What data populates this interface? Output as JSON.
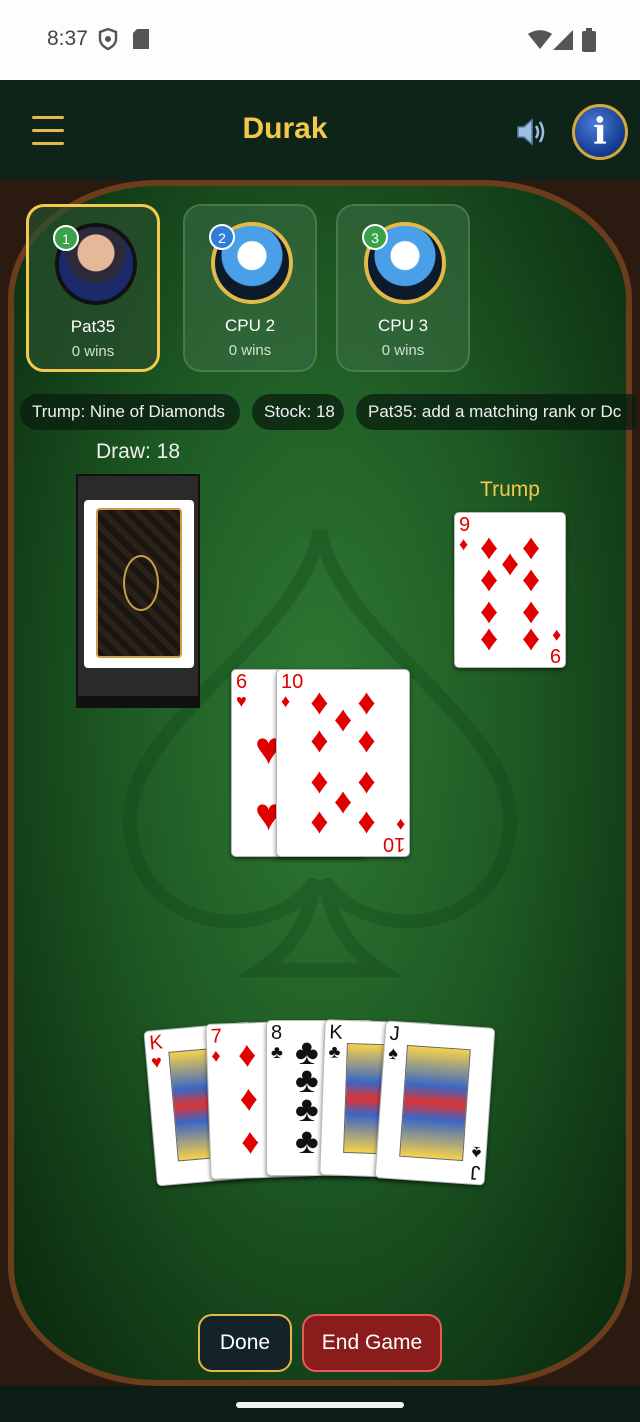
{
  "status_bar": {
    "time": "8:37",
    "icons": [
      "shield-icon",
      "sim-card-icon",
      "wifi-icon",
      "signal-icon",
      "battery-icon"
    ]
  },
  "app_bar": {
    "title": "Durak",
    "menu_icon": "hamburger-icon",
    "sound_icon": "speaker-icon",
    "info_icon": "info-icon",
    "info_glyph": "i"
  },
  "players": [
    {
      "badge": "1",
      "name": "Pat35",
      "wins": "0 wins",
      "active": true,
      "badge_color": "#3aa34a"
    },
    {
      "badge": "2",
      "name": "CPU 2",
      "wins": "0 wins",
      "active": false,
      "badge_color": "#2f7fd8"
    },
    {
      "badge": "3",
      "name": "CPU 3",
      "wins": "0 wins",
      "active": false,
      "badge_color": "#3aa34a"
    }
  ],
  "info": {
    "trump": "Trump: Nine of Diamonds",
    "stock": "Stock: 18",
    "status": "Pat35: add a matching rank or Dc"
  },
  "draw_label": "Draw: 18",
  "trump_label": "Trump",
  "trump_card": {
    "rank": "9",
    "suit": "♦",
    "color": "red"
  },
  "table_cards": [
    {
      "rank": "6",
      "suit": "♥",
      "color": "red"
    },
    {
      "rank": "10",
      "suit": "♦",
      "color": "red"
    }
  ],
  "hand": [
    {
      "rank": "K",
      "suit": "♥",
      "color": "red"
    },
    {
      "rank": "7",
      "suit": "♦",
      "color": "red"
    },
    {
      "rank": "8",
      "suit": "♣",
      "color": "black"
    },
    {
      "rank": "K",
      "suit": "♣",
      "color": "black"
    },
    {
      "rank": "J",
      "suit": "♠",
      "color": "black"
    }
  ],
  "buttons": {
    "done": "Done",
    "end_game": "End Game"
  },
  "colors": {
    "accent": "#f2c94c",
    "felt": "#1e5a24",
    "end_button": "#8a1c1c"
  }
}
